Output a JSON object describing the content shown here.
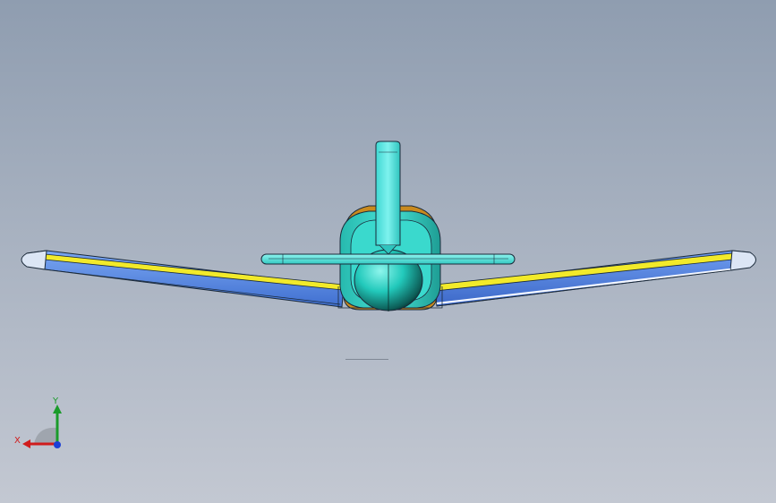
{
  "scene": {
    "background_top": "#8f9db0",
    "background_bottom": "#c3c8d2",
    "model": "airplane-front-view"
  },
  "colors": {
    "wing_blue": "#5c8ee8",
    "wing_yellow": "#f2ea2a",
    "fuselage_cyan": "#2cd3c6",
    "tail_cyan": "#49e6e0",
    "edge_dark": "#1b2a3a"
  },
  "triad": {
    "x_label": "X",
    "y_label": "Y",
    "x_color": "#d01c1c",
    "y_color": "#1a9b2a",
    "z_color": "#1b3fd6"
  }
}
